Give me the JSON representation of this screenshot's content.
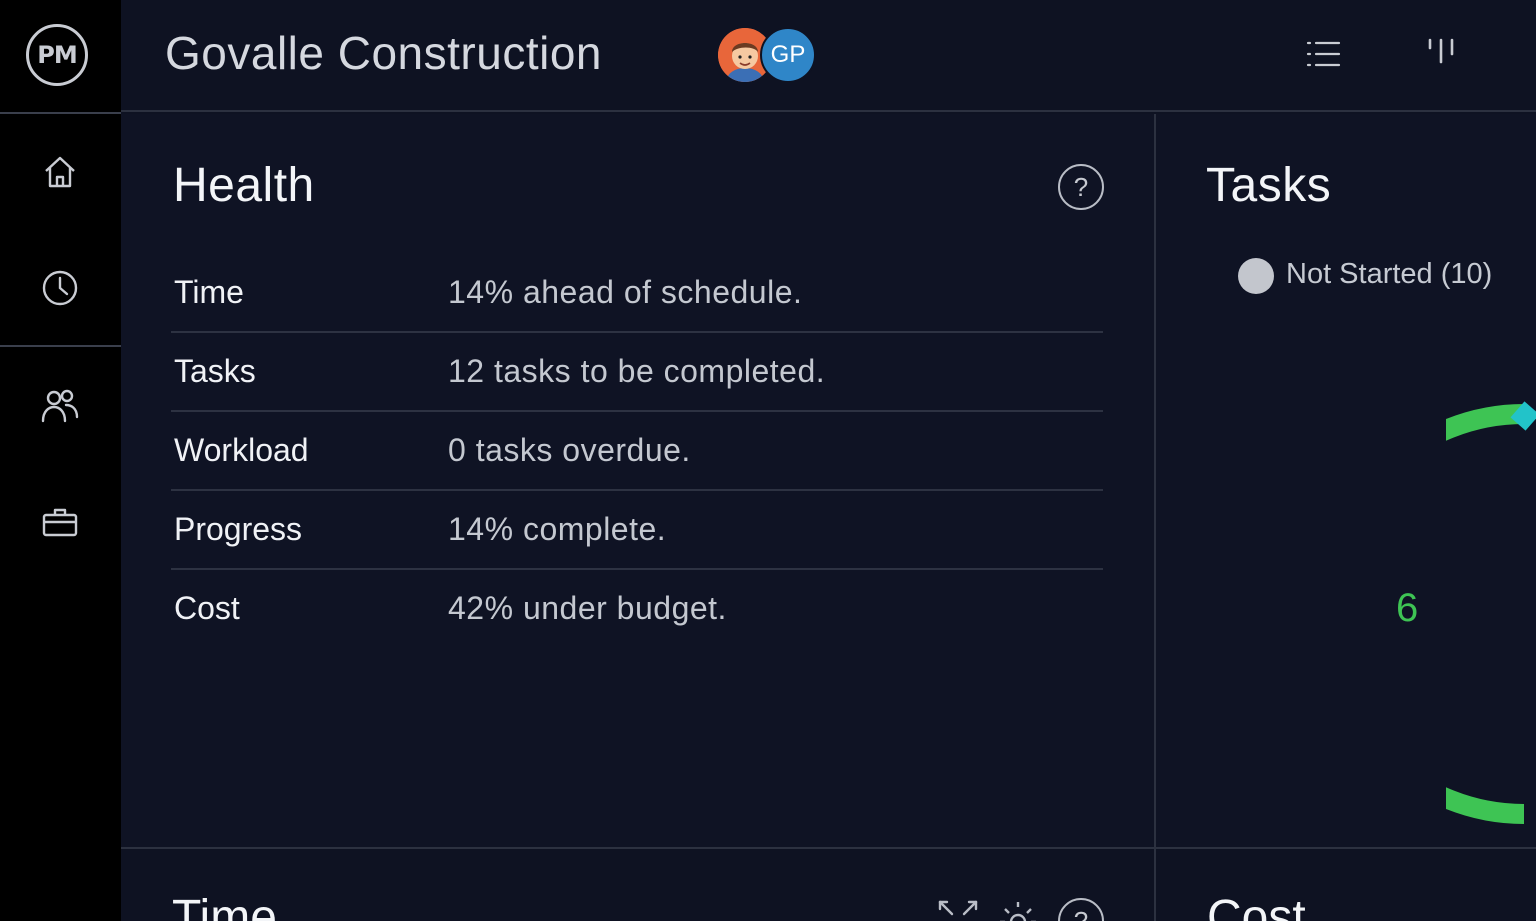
{
  "app": {
    "logo_text": "PM"
  },
  "header": {
    "project_title": "Govalle Construction",
    "avatar_initials": "GP",
    "list_view_icon": "list-icon",
    "board_view_icon": "columns-icon"
  },
  "sidebar": {
    "items": [
      {
        "icon": "home-icon"
      },
      {
        "icon": "clock-icon"
      },
      {
        "icon": "people-icon"
      },
      {
        "icon": "briefcase-icon"
      }
    ]
  },
  "health": {
    "title": "Health",
    "help_label": "?",
    "rows": [
      {
        "label": "Time",
        "value": "14% ahead of schedule."
      },
      {
        "label": "Tasks",
        "value": "12 tasks to be completed."
      },
      {
        "label": "Workload",
        "value": "0 tasks overdue."
      },
      {
        "label": "Progress",
        "value": "14% complete."
      },
      {
        "label": "Cost",
        "value": "42% under budget."
      }
    ]
  },
  "tasks": {
    "title": "Tasks",
    "legend": [
      {
        "label": "Not Started (10)",
        "color": "#c3c6cd"
      }
    ],
    "donut_label": "6",
    "colors": {
      "in_progress": "#3ec454",
      "complete": "#22c3c9"
    }
  },
  "bottom": {
    "time_title": "Time",
    "cost_title": "Cost",
    "help_label": "?"
  },
  "colors": {
    "background": "#0e1222",
    "sidebar": "#000000",
    "accent_green": "#3ec454",
    "avatar_blue": "#2f86c8"
  }
}
